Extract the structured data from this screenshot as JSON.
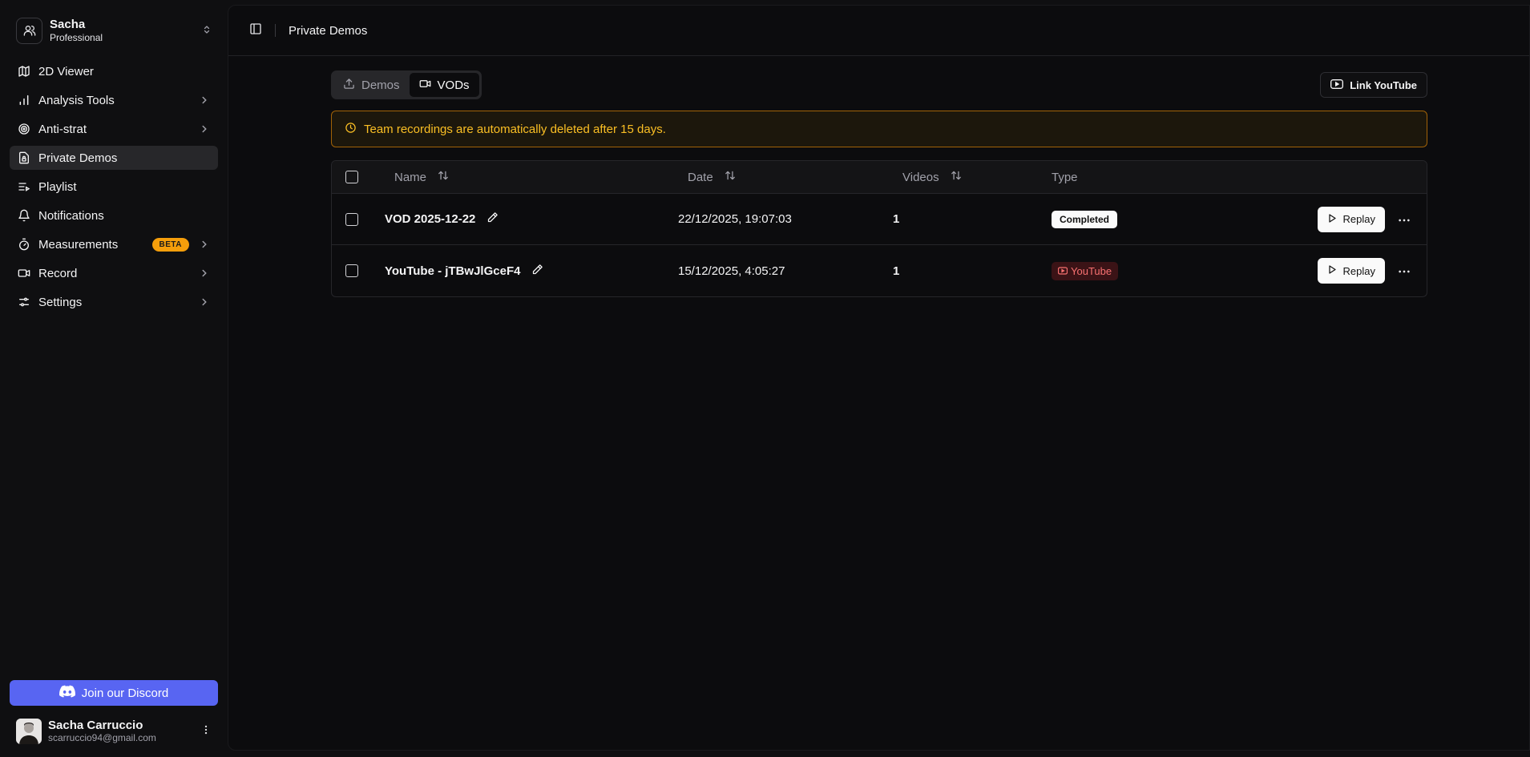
{
  "team": {
    "name": "Sacha",
    "plan": "Professional"
  },
  "nav": [
    {
      "label": "2D Viewer",
      "icon": "map-icon",
      "chevron": false
    },
    {
      "label": "Analysis Tools",
      "icon": "bar-chart-icon",
      "chevron": true
    },
    {
      "label": "Anti-strat",
      "icon": "target-icon",
      "chevron": true
    },
    {
      "label": "Private Demos",
      "icon": "file-lock-icon",
      "chevron": false,
      "active": true
    },
    {
      "label": "Playlist",
      "icon": "list-play-icon",
      "chevron": false
    },
    {
      "label": "Notifications",
      "icon": "bell-icon",
      "chevron": false
    },
    {
      "label": "Measurements",
      "icon": "timer-icon",
      "chevron": true,
      "badge": "BETA"
    },
    {
      "label": "Record",
      "icon": "video-icon",
      "chevron": true
    },
    {
      "label": "Settings",
      "icon": "sliders-icon",
      "chevron": true
    }
  ],
  "discord_label": "Join our Discord",
  "user": {
    "name": "Sacha Carruccio",
    "email": "scarruccio94@gmail.com"
  },
  "topbar": {
    "title": "Private Demos"
  },
  "tabs": [
    {
      "label": "Demos",
      "active": false
    },
    {
      "label": "VODs",
      "active": true
    }
  ],
  "link_youtube_label": "Link YouTube",
  "alert_text": "Team recordings are automatically deleted after 15 days.",
  "table": {
    "headers": {
      "name": "Name",
      "date": "Date",
      "videos": "Videos",
      "type": "Type"
    },
    "rows": [
      {
        "name": "VOD 2025-12-22",
        "date": "22/12/2025, 19:07:03",
        "videos": "1",
        "type": "Completed",
        "action": "Replay"
      },
      {
        "name": "YouTube - jTBwJlGceF4",
        "date": "15/12/2025, 4:05:27",
        "videos": "1",
        "type": "YouTube",
        "action": "Replay"
      }
    ]
  },
  "colors": {
    "accent_discord": "#5865f2",
    "beta": "#f59e0b",
    "alert": "#fbbf24",
    "youtube": "#f87171"
  }
}
